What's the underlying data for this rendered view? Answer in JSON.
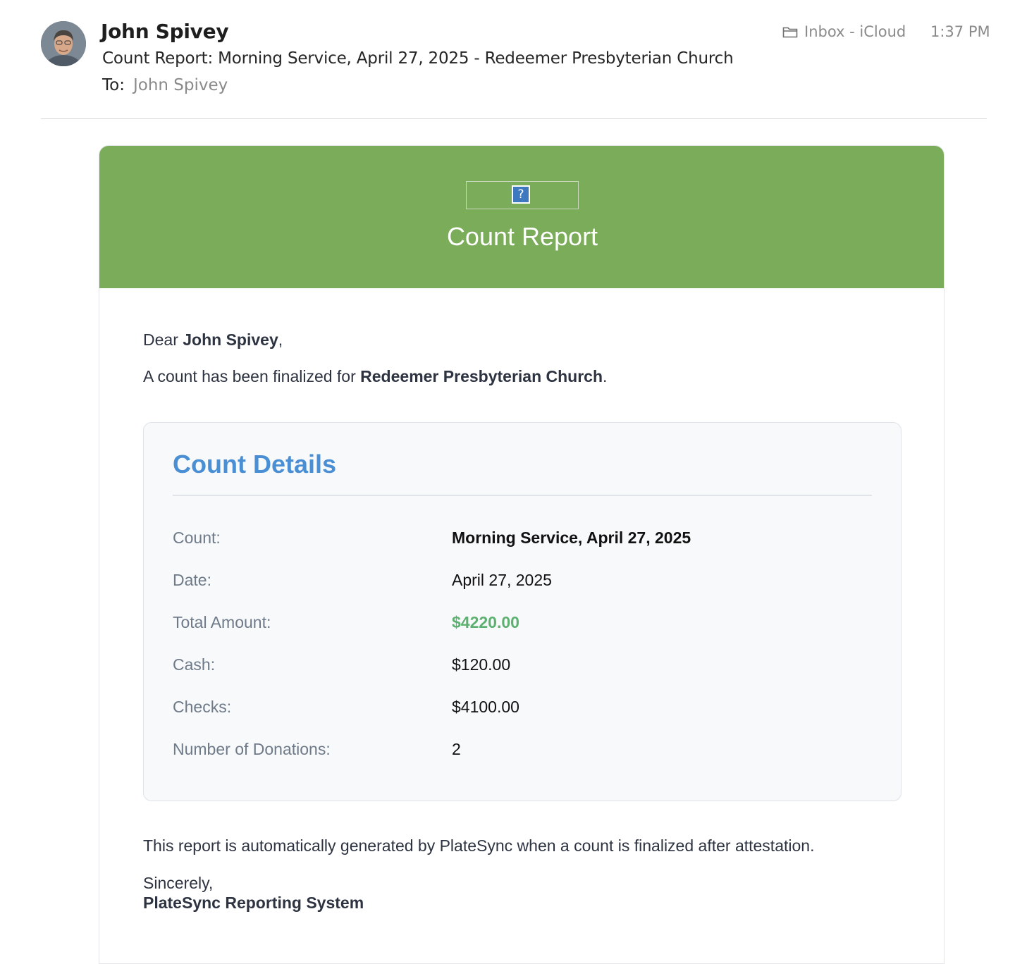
{
  "header": {
    "sender": "John Spivey",
    "subject": "Count Report: Morning Service, April 27, 2025 - Redeemer Presbyterian Church",
    "to_label": "To:",
    "to_value": "John Spivey",
    "mailbox_icon": "folder-icon",
    "mailbox": "Inbox - iCloud",
    "time": "1:37 PM"
  },
  "email": {
    "banner_color": "#7aac59",
    "banner_image_placeholder": "?",
    "banner_title": "Count Report",
    "greeting_prefix": "Dear ",
    "greeting_name": "John Spivey",
    "greeting_suffix": ",",
    "intro_prefix": "A count has been finalized for ",
    "intro_church": "Redeemer Presbyterian Church",
    "intro_suffix": ".",
    "details": {
      "title": "Count Details",
      "title_color": "#4a8fd4",
      "rows": [
        {
          "label": "Count:",
          "value": "Morning Service, April 27, 2025"
        },
        {
          "label": "Date:",
          "value": "April 27, 2025"
        },
        {
          "label": "Total Amount:",
          "value": "$4220.00"
        },
        {
          "label": "Cash:",
          "value": "$120.00"
        },
        {
          "label": "Checks:",
          "value": "$4100.00"
        },
        {
          "label": "Number of Donations:",
          "value": "2"
        }
      ],
      "total_color": "#5cb070"
    },
    "footer_note": "This report is automatically generated by PlateSync when a count is finalized after attestation.",
    "closing": "Sincerely,",
    "signature": "PlateSync Reporting System"
  }
}
